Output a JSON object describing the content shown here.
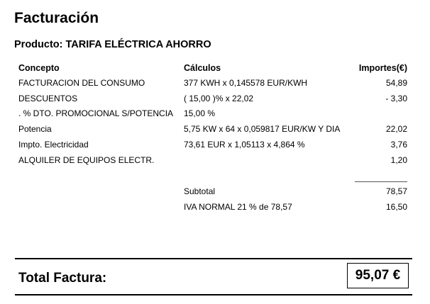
{
  "document": {
    "title": "Facturación",
    "product": "Producto: TARIFA ELÉCTRICA AHORRO"
  },
  "table": {
    "headers": {
      "concept": "Concepto",
      "calc": "Cálculos",
      "amount": "Importes(€)"
    },
    "rows": [
      {
        "concept": "FACTURACION DEL CONSUMO",
        "calc": "377 KWH x 0,145578 EUR/KWH",
        "amount": "54,89"
      },
      {
        "concept": "DESCUENTOS",
        "calc": "( 15,00 )% x 22,02",
        "amount": "- 3,30"
      },
      {
        "concept": ". % DTO. PROMOCIONAL S/POTENCIA",
        "calc": "15,00 %",
        "amount": ""
      },
      {
        "concept": "Potencia",
        "calc": "5,75 KW x 64 x 0,059817 EUR/KW Y DIA",
        "amount": "22,02"
      },
      {
        "concept": "Impto. Electricidad",
        "calc": "73,61 EUR x 1,05113 x 4,864 %",
        "amount": "3,76"
      },
      {
        "concept": "ALQUILER DE EQUIPOS ELECTR.",
        "calc": "",
        "amount": "1,20"
      }
    ]
  },
  "summary": {
    "subtotal_label": "Subtotal",
    "subtotal_value": "78,57",
    "iva_label": "IVA NORMAL 21 % de 78,57",
    "iva_value": "16,50"
  },
  "total": {
    "label": "Total Factura:",
    "value": "95,07 €"
  }
}
